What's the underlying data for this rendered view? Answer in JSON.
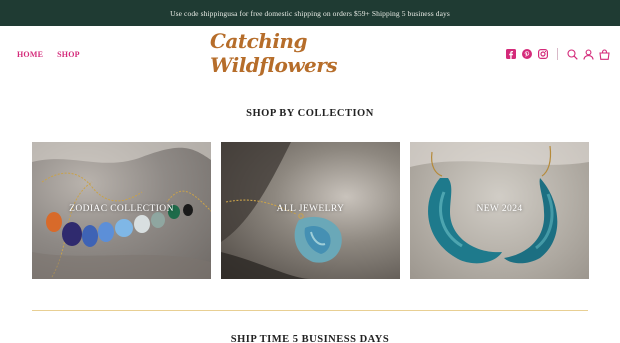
{
  "announcement": {
    "text": "Use code shippingusa for free domestic shipping on orders $59+ Shipping 5 business days"
  },
  "nav": {
    "items": [
      {
        "label": "HOME"
      },
      {
        "label": "SHOP"
      }
    ]
  },
  "logo": {
    "text": "Catching Wildflowers"
  },
  "header_icons": [
    "facebook-icon",
    "pinterest-icon",
    "instagram-icon",
    "search-icon",
    "account-icon",
    "cart-icon"
  ],
  "collections": {
    "title": "SHOP BY COLLECTION",
    "tiles": [
      {
        "label": "ZODIAC COLLECTION"
      },
      {
        "label": "ALL JEWELRY"
      },
      {
        "label": "NEW 2024"
      }
    ]
  },
  "ship_section": {
    "title": "SHIP TIME 5 BUSINESS DAYS"
  },
  "colors": {
    "announcement_bg": "#1f3b33",
    "nav_pink": "#d42a7a",
    "logo_brown": "#b66d2a",
    "divider_gold": "#e8cf93"
  }
}
